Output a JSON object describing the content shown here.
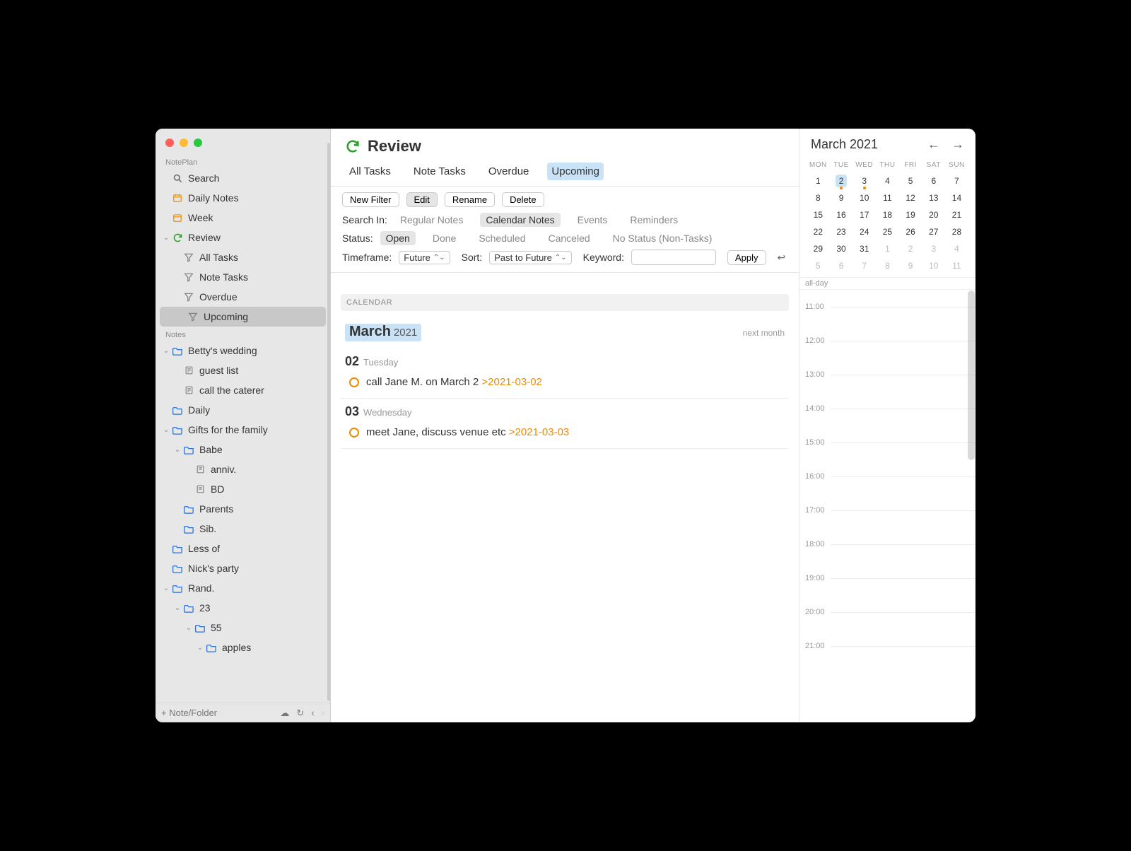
{
  "app_name": "NotePlan",
  "sidebar": {
    "search_label": "Search",
    "daily_label": "Daily Notes",
    "week_label": "Week",
    "review_label": "Review",
    "review_children": {
      "all_tasks": "All Tasks",
      "note_tasks": "Note Tasks",
      "overdue": "Overdue",
      "upcoming": "Upcoming"
    },
    "notes_section_label": "Notes",
    "notes": {
      "betty": "Betty's wedding",
      "guest_list": "guest list",
      "call_caterer": "call the caterer",
      "daily": "Daily",
      "gifts": "Gifts for the family",
      "babe": "Babe",
      "anniv": "anniv.",
      "bd": "BD",
      "parents": "Parents",
      "sib": "Sib.",
      "less_of": "Less of",
      "nicks_party": "Nick's party",
      "rand": "Rand.",
      "n23": "23",
      "n55": "55",
      "apples": "apples"
    },
    "footer_add": "Note/Folder"
  },
  "main": {
    "title": "Review",
    "tabs": {
      "all_tasks": "All Tasks",
      "note_tasks": "Note Tasks",
      "overdue": "Overdue",
      "upcoming": "Upcoming"
    },
    "filter_buttons": {
      "new_filter": "New Filter",
      "edit": "Edit",
      "rename": "Rename",
      "delete": "Delete"
    },
    "search_in": {
      "label": "Search In:",
      "regular": "Regular Notes",
      "calendar": "Calendar Notes",
      "events": "Events",
      "reminders": "Reminders"
    },
    "status": {
      "label": "Status:",
      "open": "Open",
      "done": "Done",
      "scheduled": "Scheduled",
      "canceled": "Canceled",
      "no_status": "No Status (Non-Tasks)"
    },
    "timeframe_label": "Timeframe:",
    "timeframe_value": "Future",
    "sort_label": "Sort:",
    "sort_value": "Past to Future",
    "keyword_label": "Keyword:",
    "apply": "Apply",
    "section_calendar": "CALENDAR",
    "month_name": "March",
    "month_year": "2021",
    "next_month": "next month",
    "days": [
      {
        "num": "02",
        "name": "Tuesday",
        "task_text": "call Jane M. on March 2 ",
        "task_date": ">2021-03-02"
      },
      {
        "num": "03",
        "name": "Wednesday",
        "task_text": "meet Jane, discuss venue etc ",
        "task_date": ">2021-03-03"
      }
    ]
  },
  "calendar": {
    "header": "March 2021",
    "dow": [
      "MON",
      "TUE",
      "WED",
      "THU",
      "FRI",
      "SAT",
      "SUN"
    ],
    "weeks": [
      [
        {
          "n": "1"
        },
        {
          "n": "2",
          "sel": true,
          "evt": true
        },
        {
          "n": "3",
          "evt": true
        },
        {
          "n": "4"
        },
        {
          "n": "5"
        },
        {
          "n": "6"
        },
        {
          "n": "7"
        }
      ],
      [
        {
          "n": "8"
        },
        {
          "n": "9"
        },
        {
          "n": "10"
        },
        {
          "n": "11"
        },
        {
          "n": "12"
        },
        {
          "n": "13"
        },
        {
          "n": "14"
        }
      ],
      [
        {
          "n": "15"
        },
        {
          "n": "16"
        },
        {
          "n": "17"
        },
        {
          "n": "18"
        },
        {
          "n": "19"
        },
        {
          "n": "20"
        },
        {
          "n": "21"
        }
      ],
      [
        {
          "n": "22"
        },
        {
          "n": "23"
        },
        {
          "n": "24"
        },
        {
          "n": "25"
        },
        {
          "n": "26"
        },
        {
          "n": "27"
        },
        {
          "n": "28"
        }
      ],
      [
        {
          "n": "29"
        },
        {
          "n": "30"
        },
        {
          "n": "31"
        },
        {
          "n": "1",
          "dim": true
        },
        {
          "n": "2",
          "dim": true
        },
        {
          "n": "3",
          "dim": true
        },
        {
          "n": "4",
          "dim": true
        }
      ],
      [
        {
          "n": "5",
          "dim": true
        },
        {
          "n": "6",
          "dim": true
        },
        {
          "n": "7",
          "dim": true
        },
        {
          "n": "8",
          "dim": true
        },
        {
          "n": "9",
          "dim": true
        },
        {
          "n": "10",
          "dim": true
        },
        {
          "n": "11",
          "dim": true
        }
      ]
    ],
    "allday_label": "all-day",
    "hours": [
      "11:00",
      "12:00",
      "13:00",
      "14:00",
      "15:00",
      "16:00",
      "17:00",
      "18:00",
      "19:00",
      "20:00",
      "21:00"
    ]
  }
}
